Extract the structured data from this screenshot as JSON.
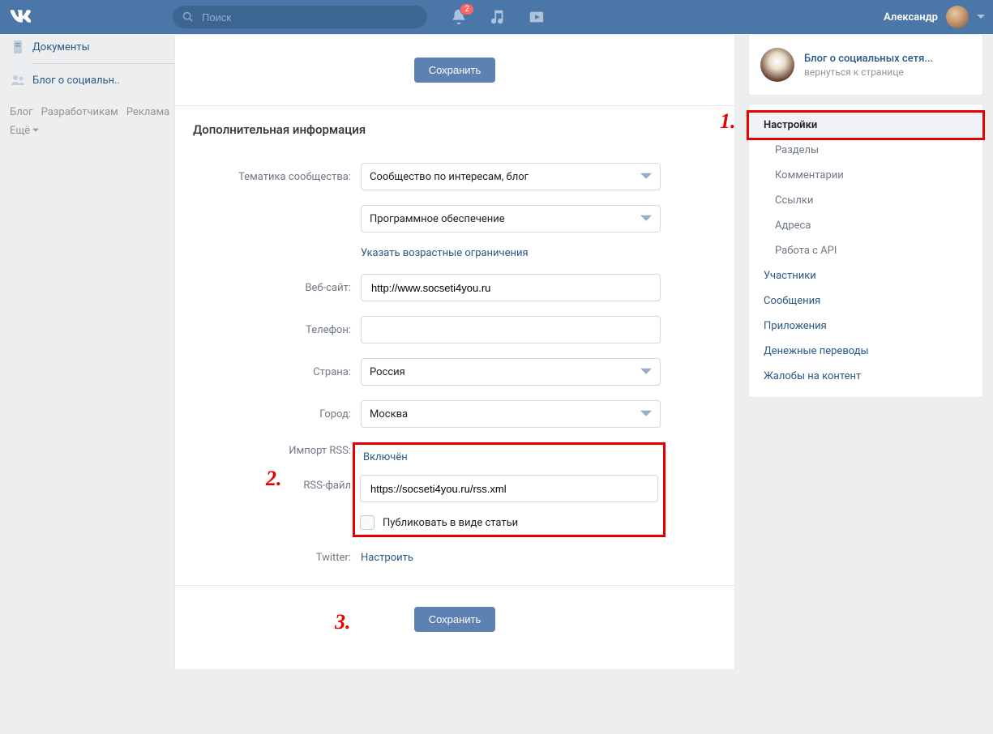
{
  "header": {
    "search_placeholder": "Поиск",
    "notif_badge": "2",
    "user_name": "Александр"
  },
  "left_nav": {
    "documents": "Документы",
    "blog": "Блог о социальн..",
    "footer": [
      "Блог",
      "Разработчикам",
      "Реклама",
      "Ещё"
    ]
  },
  "form": {
    "top_save": "Сохранить",
    "title": "Дополнительная информация",
    "topic_label": "Тематика сообщества:",
    "topic_value1": "Сообщество по интересам, блог",
    "topic_value2": "Программное обеспечение",
    "age_link": "Указать возрастные ограничения",
    "website_label": "Веб-сайт:",
    "website_value": "http://www.socseti4you.ru",
    "phone_label": "Телефон:",
    "phone_value": "",
    "country_label": "Страна:",
    "country_value": "Россия",
    "city_label": "Город:",
    "city_value": "Москва",
    "rss_import_label": "Импорт RSS:",
    "rss_import_value": "Включён",
    "rss_file_label": "RSS-файл",
    "rss_file_value": "https://socseti4you.ru/rss.xml",
    "publish_article": "Публиковать в виде статьи",
    "twitter_label": "Twitter:",
    "twitter_value": "Настроить",
    "bottom_save": "Сохранить"
  },
  "annotations": {
    "n1": "1.",
    "n2": "2.",
    "n3": "3."
  },
  "sidebar": {
    "group_title": "Блог о социальных сетя...",
    "group_back": "вернуться к странице",
    "items": [
      {
        "label": "Настройки",
        "selected": true
      },
      {
        "label": "Разделы",
        "sub": true
      },
      {
        "label": "Комментарии",
        "sub": true
      },
      {
        "label": "Ссылки",
        "sub": true
      },
      {
        "label": "Адреса",
        "sub": true
      },
      {
        "label": "Работа с API",
        "sub": true
      },
      {
        "label": "Участники"
      },
      {
        "label": "Сообщения"
      },
      {
        "label": "Приложения"
      },
      {
        "label": "Денежные переводы"
      },
      {
        "label": "Жалобы на контент"
      }
    ]
  }
}
